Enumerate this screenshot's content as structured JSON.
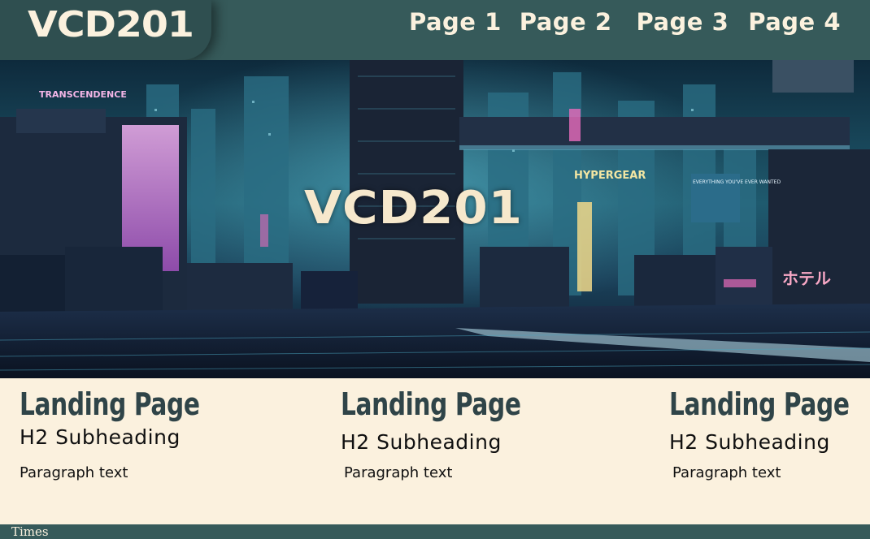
{
  "header": {
    "logo": "VCD201",
    "nav": [
      {
        "label": "Page 1"
      },
      {
        "label": "Page 2"
      },
      {
        "label": "Page 3"
      },
      {
        "label": "Page 4"
      }
    ]
  },
  "hero": {
    "title": "VCD201",
    "signs": {
      "left": "TRANSCENDENCE",
      "center": "HYPERGEAR",
      "right_jp": "ホテル",
      "tower_ad": "EVERYTHING YOU'VE EVER WANTED"
    }
  },
  "columns": [
    {
      "heading": "Landing Page",
      "subheading": "H2 Subheading",
      "paragraph": "Paragraph text"
    },
    {
      "heading": "Landing Page",
      "subheading": "H2 Subheading",
      "paragraph": "Paragraph text"
    },
    {
      "heading": "Landing Page",
      "subheading": "H2 Subheading",
      "paragraph": "Paragraph text"
    }
  ],
  "footer": {
    "text": "Times"
  },
  "colors": {
    "header_bg": "#365a5a",
    "logo_bg": "#2f4f50",
    "cream": "#fbf1de",
    "heading_text": "#2f4448"
  }
}
